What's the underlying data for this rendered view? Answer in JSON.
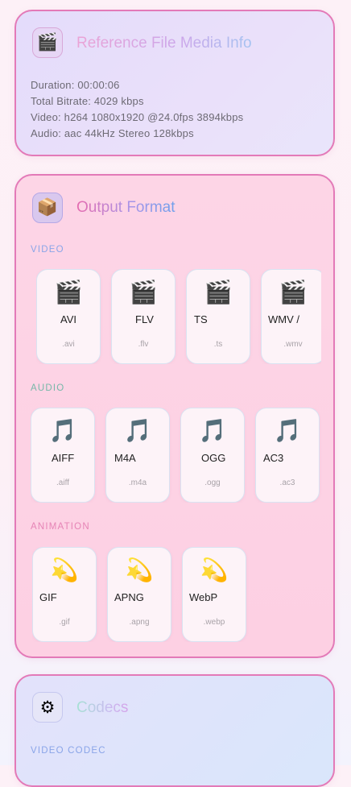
{
  "info_card": {
    "icon": "clapper-board-icon",
    "title": "Reference File Media Info",
    "duration": "Duration: 00:00:06",
    "bitrate": "Total Bitrate: 4029 kbps",
    "video": "Video: h264 1080x1920 @24.0fps 3894kbps",
    "audio": "Audio: aac 44kHz Stereo 128kbps"
  },
  "output_card": {
    "icon": "package-icon",
    "title": "Output Format",
    "video_label": "VIDEO",
    "video_formats": [
      {
        "name": "AVI",
        "ext": ".avi"
      },
      {
        "name": "FLV",
        "ext": ".flv"
      },
      {
        "name": "TS",
        "ext": ".ts"
      },
      {
        "name": "WMV /",
        "ext": ".wmv"
      }
    ],
    "audio_label": "AUDIO",
    "audio_formats": [
      {
        "name": "AIFF",
        "ext": ".aiff"
      },
      {
        "name": "M4A",
        "ext": ".m4a"
      },
      {
        "name": "OGG",
        "ext": ".ogg"
      },
      {
        "name": "AC3",
        "ext": ".ac3"
      }
    ],
    "animation_label": "ANIMATION",
    "animation_formats": [
      {
        "name": "GIF",
        "ext": ".gif"
      },
      {
        "name": "APNG",
        "ext": ".apng"
      },
      {
        "name": "WebP",
        "ext": ".webp"
      }
    ]
  },
  "codecs_card": {
    "icon": "gear-icon",
    "title": "Codecs",
    "video_codec_label": "VIDEO CODEC"
  },
  "colors": {
    "card_border": "#e37ab8",
    "video_label": "#8aa5e8",
    "audio_label": "#76b8a8",
    "animation_label": "#e684b6"
  }
}
